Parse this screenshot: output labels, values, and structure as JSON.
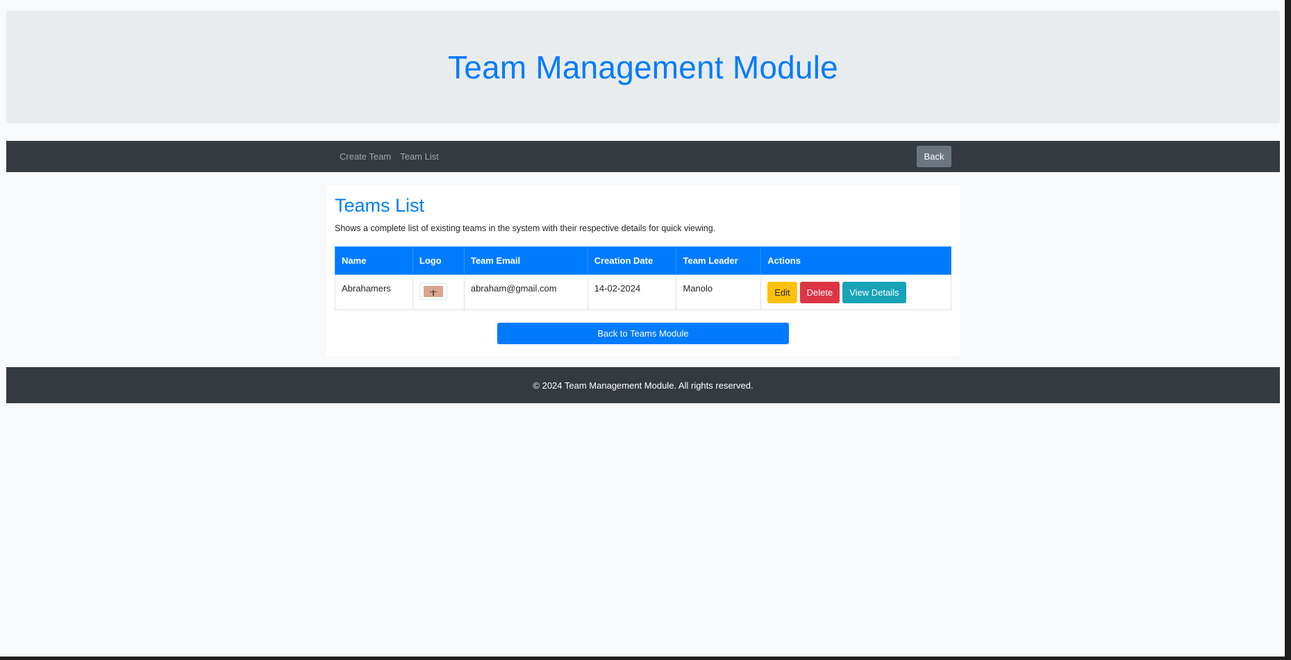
{
  "header": {
    "title": "Team Management Module"
  },
  "navbar": {
    "links": [
      "Create Team",
      "Team List"
    ],
    "back_label": "Back"
  },
  "main": {
    "title": "Teams List",
    "description": "Shows a complete list of existing teams in the system with their respective details for quick viewing.",
    "table": {
      "columns": [
        "Name",
        "Logo",
        "Team Email",
        "Creation Date",
        "Team Leader",
        "Actions"
      ],
      "rows": [
        {
          "name": "Abrahamers",
          "email": "abraham@gmail.com",
          "creation_date": "14-02-2024",
          "leader": "Manolo",
          "actions": {
            "edit": "Edit",
            "delete": "Delete",
            "view": "View Details"
          }
        }
      ]
    },
    "back_to_module_label": "Back to Teams Module"
  },
  "footer": {
    "text": "© 2024 Team Management Module. All rights reserved."
  },
  "colors": {
    "primary": "#007bff",
    "dark": "#343a40",
    "secondary": "#6c757d",
    "warning": "#ffc107",
    "danger": "#dc3545",
    "info": "#17a2b8"
  }
}
